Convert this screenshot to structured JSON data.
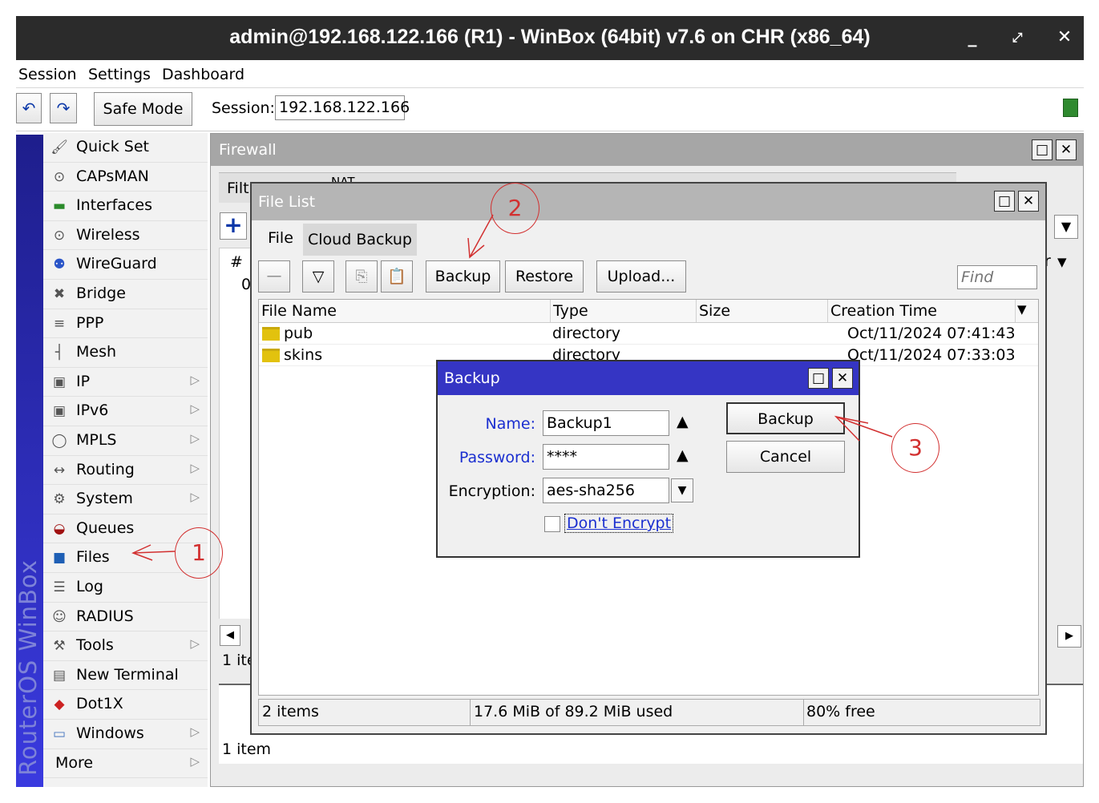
{
  "window": {
    "title": "admin@192.168.122.166 (R1) - WinBox (64bit) v7.6 on CHR (x86_64)",
    "min_icon": "minimize-icon",
    "restore_icon": "restore-icon",
    "close_icon": "close-icon"
  },
  "menu": [
    "Session",
    "Settings",
    "Dashboard"
  ],
  "toolbar": {
    "undo_icon": "undo-icon",
    "redo_icon": "redo-icon",
    "safe_mode": "Safe Mode",
    "session_label": "Session:",
    "session_value": "192.168.122.166"
  },
  "sidebar": {
    "brand": "RouterOS WinBox",
    "items": [
      {
        "label": "Quick Set",
        "icon": "wand-icon",
        "arrow": false
      },
      {
        "label": "CAPsMAN",
        "icon": "antenna-icon",
        "arrow": false
      },
      {
        "label": "Interfaces",
        "icon": "interfaces-icon",
        "arrow": false
      },
      {
        "label": "Wireless",
        "icon": "antenna-icon",
        "arrow": false
      },
      {
        "label": "WireGuard",
        "icon": "wireguard-icon",
        "arrow": false
      },
      {
        "label": "Bridge",
        "icon": "bridge-icon",
        "arrow": false
      },
      {
        "label": "PPP",
        "icon": "ppp-icon",
        "arrow": false
      },
      {
        "label": "Mesh",
        "icon": "mesh-icon",
        "arrow": false
      },
      {
        "label": "IP",
        "icon": "ip-icon",
        "arrow": true
      },
      {
        "label": "IPv6",
        "icon": "ipv6-icon",
        "arrow": true
      },
      {
        "label": "MPLS",
        "icon": "mpls-icon",
        "arrow": true
      },
      {
        "label": "Routing",
        "icon": "routing-icon",
        "arrow": true
      },
      {
        "label": "System",
        "icon": "gear-icon",
        "arrow": true
      },
      {
        "label": "Queues",
        "icon": "queues-icon",
        "arrow": false
      },
      {
        "label": "Files",
        "icon": "folder-icon",
        "arrow": false
      },
      {
        "label": "Log",
        "icon": "log-icon",
        "arrow": false
      },
      {
        "label": "RADIUS",
        "icon": "users-icon",
        "arrow": false
      },
      {
        "label": "Tools",
        "icon": "tools-icon",
        "arrow": true
      },
      {
        "label": "New Terminal",
        "icon": "terminal-icon",
        "arrow": false
      },
      {
        "label": "Dot1X",
        "icon": "dot1x-icon",
        "arrow": false
      },
      {
        "label": "Windows",
        "icon": "windows-icon",
        "arrow": true
      },
      {
        "label": "More",
        "icon": "",
        "arrow": true
      }
    ]
  },
  "firewall": {
    "title": "Firewall",
    "tab_partial": "Filt",
    "tab_partial2": "NAT",
    "hash_col": "#",
    "row_partial": "0",
    "items_partial": "1 ite",
    "items_full": "1 item",
    "right_partial": "r"
  },
  "filelist": {
    "title": "File List",
    "tabs": [
      "File",
      "Cloud Backup"
    ],
    "buttons": {
      "backup": "Backup",
      "restore": "Restore",
      "upload": "Upload..."
    },
    "find_placeholder": "Find",
    "columns": [
      "File Name",
      "Type",
      "Size",
      "Creation Time"
    ],
    "rows": [
      {
        "name": "pub",
        "type": "directory",
        "size": "",
        "created": "Oct/11/2024 07:41:43"
      },
      {
        "name": "skins",
        "type": "directory",
        "size": "",
        "created": "Oct/11/2024 07:33:03"
      }
    ],
    "status": {
      "count": "2 items",
      "used": "17.6 MiB of 89.2 MiB used",
      "free": "80% free"
    }
  },
  "backup_dialog": {
    "title": "Backup",
    "name_label": "Name:",
    "name_value": "Backup1",
    "password_label": "Password:",
    "password_value": "****",
    "encryption_label": "Encryption:",
    "encryption_value": "aes-sha256",
    "dont_encrypt": "Don't Encrypt",
    "backup_button": "Backup",
    "cancel_button": "Cancel"
  },
  "annotations": {
    "one": "1",
    "two": "2",
    "three": "3"
  },
  "colors": {
    "accent_blue": "#0a37a8",
    "annotation_red": "#d23030",
    "dialog_title": "#3535c4"
  }
}
